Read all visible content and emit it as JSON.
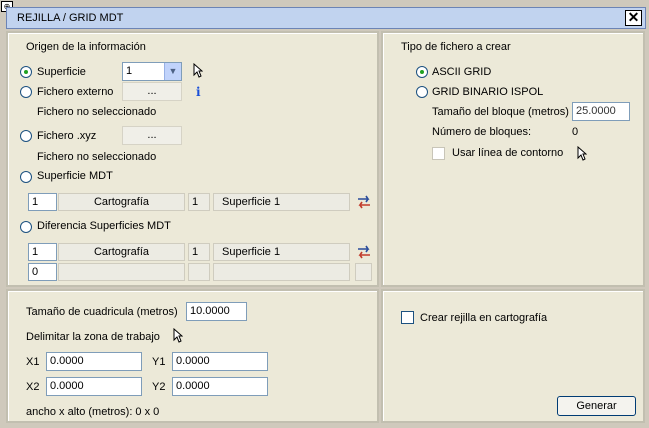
{
  "window": {
    "title": "REJILLA / GRID MDT",
    "close": "✕"
  },
  "source": {
    "heading": "Origen de la información",
    "opt_superficie": "Superficie",
    "superficie_value": "1",
    "opt_externo": "Fichero externo",
    "browse_label": "...",
    "info_icon": "i",
    "externo_status": "Fichero no seleccionado",
    "opt_xyz": "Fichero .xyz",
    "xyz_status": "Fichero no seleccionado",
    "opt_mdt": "Superficie MDT",
    "mdt_row": {
      "num1": "1",
      "carto": "Cartografía",
      "num2": "1",
      "surf": "Superficie 1"
    },
    "opt_diff": "Diferencia Superficies MDT",
    "diff_row1": {
      "num1": "1",
      "carto": "Cartografía",
      "num2": "1",
      "surf": "Superficie 1"
    },
    "diff_row2": {
      "num1": "0"
    }
  },
  "filetype": {
    "heading": "Tipo de fichero a crear",
    "opt_ascii": "ASCII GRID",
    "opt_binary": "GRID BINARIO ISPOL",
    "block_size_label": "Tamaño del bloque (metros)",
    "block_size_value": "25.0000",
    "block_count_label": "Número de bloques:",
    "block_count_value": "0",
    "contour_label": "Usar línea de contorno"
  },
  "grid": {
    "cell_label": "Tamaño de cuadricula (metros)",
    "cell_value": "10.0000",
    "zone_label": "Delimitar la zona de trabajo",
    "x1_label": "X1",
    "x1_value": "0.0000",
    "y1_label": "Y1",
    "y1_value": "0.0000",
    "x2_label": "X2",
    "x2_value": "0.0000",
    "y2_label": "Y2",
    "y2_value": "0.0000",
    "size_text": "ancho x alto (metros): 0 x 0"
  },
  "output": {
    "create_label": "Crear rejilla en cartografía",
    "generate_label": "Generar"
  }
}
